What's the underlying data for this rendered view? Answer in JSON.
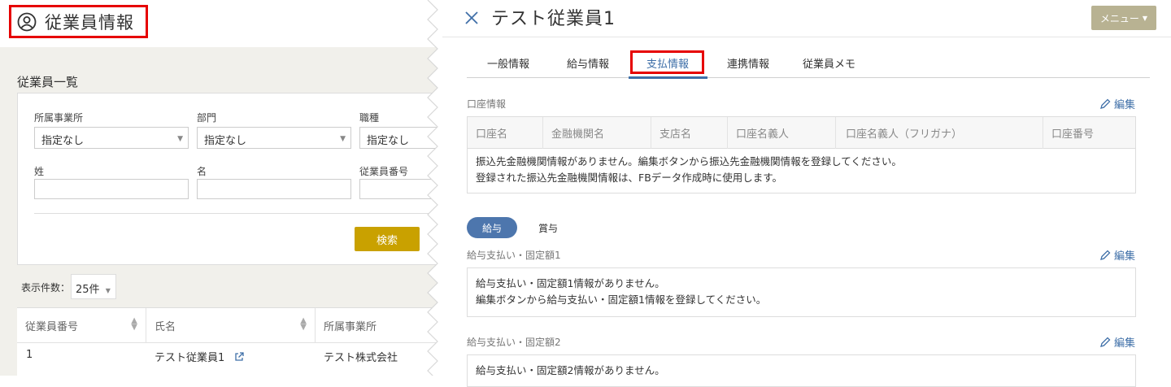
{
  "left": {
    "title": "従業員情報",
    "list_title": "従業員一覧",
    "filters": {
      "office_label": "所属事業所",
      "office_value": "指定なし",
      "dept_label": "部門",
      "dept_value": "指定なし",
      "job_label": "職種",
      "job_value": "指定なし",
      "last_name_label": "姓",
      "first_name_label": "名",
      "emp_no_label": "従業員番号"
    },
    "search_label": "検索",
    "count_label": "表示件数：",
    "count_value": "25件",
    "table": {
      "headers": [
        "従業員番号",
        "氏名",
        "所属事業所"
      ],
      "rows": [
        {
          "no": "1",
          "name": "テスト従業員1",
          "office": "テスト株式会社"
        }
      ]
    }
  },
  "right": {
    "employee_name": "テスト従業員1",
    "menu_label": "メニュー",
    "tabs": [
      "一般情報",
      "給与情報",
      "支払情報",
      "連携情報",
      "従業員メモ"
    ],
    "active_tab": "支払情報",
    "edit_label": "編集",
    "account": {
      "label": "口座情報",
      "headers": [
        "口座名",
        "金融機関名",
        "支店名",
        "口座名義人",
        "口座名義人（フリガナ）",
        "口座番号"
      ],
      "msg1": "振込先金融機関情報がありません。編集ボタンから振込先金融機関情報を登録してください。",
      "msg2": "登録された振込先金融機関情報は、FBデータ作成時に使用します。"
    },
    "pills": {
      "salary": "給与",
      "bonus": "賞与"
    },
    "fixed1": {
      "label": "給与支払い・固定額1",
      "msg1": "給与支払い・固定額1情報がありません。",
      "msg2": "編集ボタンから給与支払い・固定額1情報を登録してください。"
    },
    "fixed2": {
      "label": "給与支払い・固定額2",
      "msg1": "給与支払い・固定額2情報がありません。"
    }
  },
  "colors": {
    "accent_blue": "#3f6fa8",
    "search_gold": "#c9a100",
    "menu_khaki": "#b8b292",
    "highlight_red": "#e60000"
  }
}
